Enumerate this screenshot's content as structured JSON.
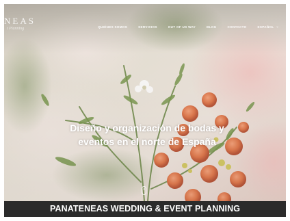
{
  "logo": {
    "name": "NEAS",
    "tagline": "t Planning"
  },
  "nav": {
    "items": [
      {
        "label": "QUIÉNES SOMOS"
      },
      {
        "label": "SERVICIOS"
      },
      {
        "label": "OUT OF US WAY"
      },
      {
        "label": "BLOG"
      },
      {
        "label": "CONTACTO"
      },
      {
        "label": "ESPAÑOL"
      }
    ]
  },
  "hero": {
    "headline_line1": "Diseño y organización de bodas y",
    "headline_line2": "eventos en el norte de España"
  },
  "caption": "PANATENEAS WEDDING & EVENT PLANNING",
  "colors": {
    "caption_bg": "#2b2b2b",
    "caption_text": "#ffffff",
    "nav_text": "#ffffff",
    "flower_orange": "#e07a4e"
  },
  "icons": {
    "scroll_indicator": "mouse-scroll-icon",
    "language_caret": "chevron-down-icon"
  }
}
